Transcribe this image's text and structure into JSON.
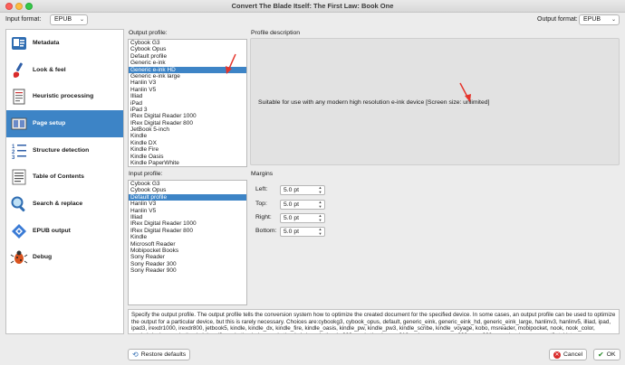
{
  "window": {
    "title": "Convert The Blade Itself: The First Law: Book One"
  },
  "input_format": {
    "label": "Input format:",
    "value": "EPUB"
  },
  "output_format": {
    "label": "Output format:",
    "value": "EPUB"
  },
  "sidebar": {
    "items": [
      {
        "label": "Metadata",
        "icon": "metadata-card-icon"
      },
      {
        "label": "Look & feel",
        "icon": "paintbrush-icon"
      },
      {
        "label": "Heuristic processing",
        "icon": "document-icon"
      },
      {
        "label": "Page setup",
        "icon": "page-setup-icon",
        "selected": true
      },
      {
        "label": "Structure detection",
        "icon": "numbered-list-icon"
      },
      {
        "label": "Table of Contents",
        "icon": "toc-icon"
      },
      {
        "label": "Search & replace",
        "icon": "magnifier-icon"
      },
      {
        "label": "EPUB output",
        "icon": "epub-icon"
      },
      {
        "label": "Debug",
        "icon": "bug-icon"
      }
    ]
  },
  "output_profile": {
    "label": "Output profile:",
    "items": [
      "Cybook G3",
      "Cybook Opus",
      "Default profile",
      "Generic e-ink",
      "Generic e-ink HD",
      "Generic e-ink large",
      "Hanlin V3",
      "Hanlin V5",
      "Illiad",
      "iPad",
      "iPad 3",
      "IRex Digital Reader 1000",
      "IRex Digital Reader 800",
      "JetBook 5-inch",
      "Kindle",
      "Kindle DX",
      "Kindle Fire",
      "Kindle Oasis",
      "Kindle PaperWhite"
    ],
    "selected": "Generic e-ink HD"
  },
  "profile_description": {
    "label": "Profile description",
    "text": "Suitable for use with any modern high resolution e-ink device [Screen size: unlimited]"
  },
  "input_profile": {
    "label": "Input profile:",
    "items": [
      "Cybook G3",
      "Cybook Opus",
      "Default profile",
      "Hanlin V3",
      "Hanlin V5",
      "Illiad",
      "IRex Digital Reader 1000",
      "IRex Digital Reader 800",
      "Kindle",
      "Microsoft Reader",
      "Mobipocket Books",
      "Sony Reader",
      "Sony Reader 300",
      "Sony Reader 900"
    ],
    "selected": "Default profile"
  },
  "margins": {
    "label": "Margins",
    "fields": [
      {
        "label": "Left:",
        "value": "5.0 pt"
      },
      {
        "label": "Top:",
        "value": "5.0 pt"
      },
      {
        "label": "Right:",
        "value": "5.0 pt"
      },
      {
        "label": "Bottom:",
        "value": "5.0 pt"
      }
    ]
  },
  "help_text": "Specify the output profile. The output profile tells the conversion system how to optimize the created document for the specified device. In some cases, an output profile can be used to optimize the output for a particular device, but this is rarely necessary. Choices are:cybookg3, cybook_opus, default, generic_eink, generic_eink_hd, generic_eink_large, hanlinv3, hanlinv5, illiad, ipad, ipad3, irexdr1000, irexdr800, jetbook5, kindle, kindle_dx, kindle_fire, kindle_oasis, kindle_pw, kindle_pw3, kindle_scribe, kindle_voyage, kobo, msreader, mobipocket, nook, nook_color, nook_hd_plus, pocketbook_inkpad3, pocketbook_lux, pocketbook_hd, pocketbook_900, pocketbook_pro_912, galaxy, sony, sony300, sony900, sony-landscape, sonyt3, tablet",
  "buttons": {
    "restore": "Restore defaults",
    "cancel": "Cancel",
    "ok": "OK"
  },
  "colors": {
    "selection": "#3d84c6",
    "annotation_arrow": "#e5342b"
  }
}
